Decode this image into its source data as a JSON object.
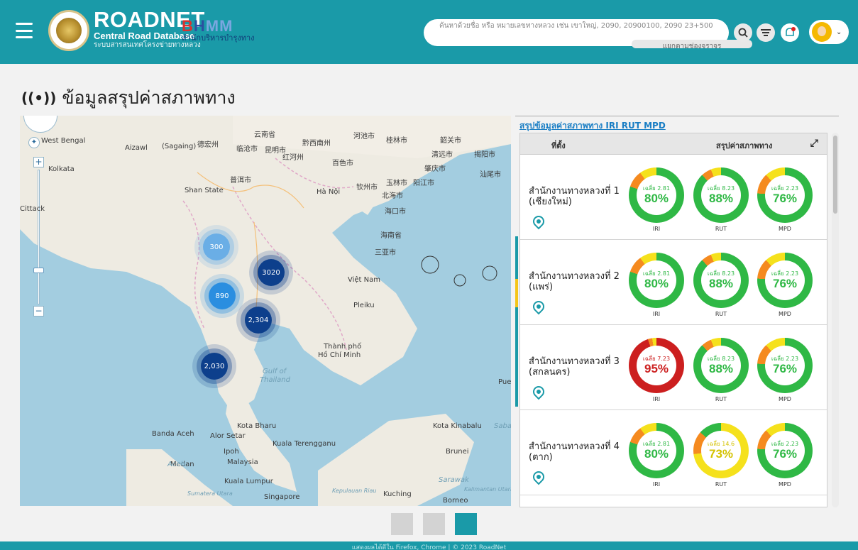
{
  "header": {
    "brand_name": "ROADNET",
    "brand_sub": "Central Road Database",
    "brand_sub_th": "ระบบสารสนเทศโครงข่ายทางหลวง",
    "partner_logo": "BHMM",
    "partner_sub": "สำนักบริหารบำรุงทาง",
    "search_placeholder": "ค้นหาด้วยชื่อ หรือ หมายเลขทางหลวง เช่น เขาใหญ่, 2090, 20900100, 2090 23+500",
    "filter_label": "แยกตามช่องจราจร",
    "icons": [
      "menu-icon",
      "search-icon",
      "filter-icon",
      "notification-icon",
      "user-avatar-icon",
      "chevron-down-icon"
    ]
  },
  "page": {
    "title": "ข้อมูลสรุปค่าสภาพทาง",
    "title_icon": "((•))"
  },
  "map": {
    "clusters": [
      "300",
      "3020",
      "890",
      "2,304",
      "2,030"
    ],
    "labels": {
      "kolkata": "Kolkata",
      "aizawl": "Aizawl",
      "west_bengal": "West Bengal",
      "sagaing": "(Sagaing)",
      "shan": "Shan State",
      "hanoi": "Hà Nội",
      "vietnam": "Việt Nam",
      "pleiku": "Pleiku",
      "hcm1": "Thành phố",
      "hcm2": "Hồ Chí Minh",
      "gulf1": "Gulf of",
      "gulf2": "Thailand",
      "kota_bharu": "Kota Bharu",
      "alor_setar": "Alor Setar",
      "kuala_terengganu": "Kuala Terengganu",
      "ipoh": "Ipoh",
      "malaysia": "Malaysia",
      "medan": "Medan",
      "banda_aceh": "Banda Aceh",
      "kuala_lumpur": "Kuala Lumpur",
      "singapore": "Singapore",
      "kuching": "Kuching",
      "kota_kinabalu": "Kota Kinabalu",
      "brunei": "Brunei",
      "borneo": "Borneo",
      "sarawak": "Sarawak",
      "kalimantan": "Kalimantan Utara",
      "sumatera": "Sumatera Utara",
      "kepulauan": "Kepulauan Riau",
      "sabah": "Sabah",
      "aceh": "Aceh",
      "chittagong": "Cittack",
      "cn1": "河池市",
      "cn2": "桂林市",
      "cn3": "韶关市",
      "cn4": "清远市",
      "cn5": "揭阳市",
      "cn6": "昆明市",
      "cn7": "黔西南州",
      "cn8": "红河州",
      "cn9": "百色市",
      "cn10": "肇庆市",
      "cn11": "玉林市",
      "cn12": "阳江市",
      "cn13": "钦州市",
      "cn14": "北海市",
      "cn15": "海口市",
      "cn16": "海南省",
      "cn17": "三亚市",
      "cn18": "普洱市",
      "cn19": "临沧市",
      "cn20": "德宏州",
      "cn21": "云南省",
      "cn22": "汕尾市",
      "pue": "Pue"
    }
  },
  "panel": {
    "title": "สรุปข้อมูลค่าสภาพทาง IRI RUT MPD",
    "col_location": "ที่ตั้ง",
    "col_summary": "สรุปค่าสภาพทาง",
    "rows": [
      {
        "office": "สำนักงานทางหลวงที่ 1 (เชียงใหม่)",
        "metrics": [
          {
            "label": "IRI",
            "avg": "เฉลี่ย 2.81",
            "pct": "80%",
            "value": 80,
            "status": "good"
          },
          {
            "label": "RUT",
            "avg": "เฉลี่ย 8.23",
            "pct": "88%",
            "value": 88,
            "status": "good"
          },
          {
            "label": "MPD",
            "avg": "เฉลี่ย 2.23",
            "pct": "76%",
            "value": 76,
            "status": "good"
          }
        ]
      },
      {
        "office": "สำนักงานทางหลวงที่ 2 (แพร่)",
        "metrics": [
          {
            "label": "IRI",
            "avg": "เฉลี่ย 2.81",
            "pct": "80%",
            "value": 80,
            "status": "good"
          },
          {
            "label": "RUT",
            "avg": "เฉลี่ย 8.23",
            "pct": "88%",
            "value": 88,
            "status": "good"
          },
          {
            "label": "MPD",
            "avg": "เฉลี่ย 2.23",
            "pct": "76%",
            "value": 76,
            "status": "good"
          }
        ]
      },
      {
        "office": "สำนักงานทางหลวงที่ 3 (สกลนคร)",
        "metrics": [
          {
            "label": "IRI",
            "avg": "เฉลี่ย 7.23",
            "pct": "95%",
            "value": 95,
            "status": "bad"
          },
          {
            "label": "RUT",
            "avg": "เฉลี่ย 8.23",
            "pct": "88%",
            "value": 88,
            "status": "good"
          },
          {
            "label": "MPD",
            "avg": "เฉลี่ย 2.23",
            "pct": "76%",
            "value": 76,
            "status": "good"
          }
        ]
      },
      {
        "office": "สำนักงานทางหลวงที่ 4 (ตาก)",
        "metrics": [
          {
            "label": "IRI",
            "avg": "เฉลี่ย 2.81",
            "pct": "80%",
            "value": 80,
            "status": "good"
          },
          {
            "label": "RUT",
            "avg": "เฉลี่ย 14.6",
            "pct": "73%",
            "value": 73,
            "status": "medium"
          },
          {
            "label": "MPD",
            "avg": "เฉลี่ย 2.23",
            "pct": "76%",
            "value": 76,
            "status": "good"
          }
        ]
      }
    ]
  },
  "pager": {
    "pages": 3,
    "active": 3
  },
  "footer": {
    "text": "แสดงผลได้ดีใน Firefox, Chrome | © 2023 RoadNet"
  },
  "colors": {
    "primary": "#1a9aa8",
    "good": "#2fb845",
    "medium": "#f5e11c",
    "bad": "#cc1f1f",
    "accent_orange": "#f58a1f",
    "cluster_light": "#4a9fe0",
    "cluster_dark": "#0d3f8c"
  }
}
